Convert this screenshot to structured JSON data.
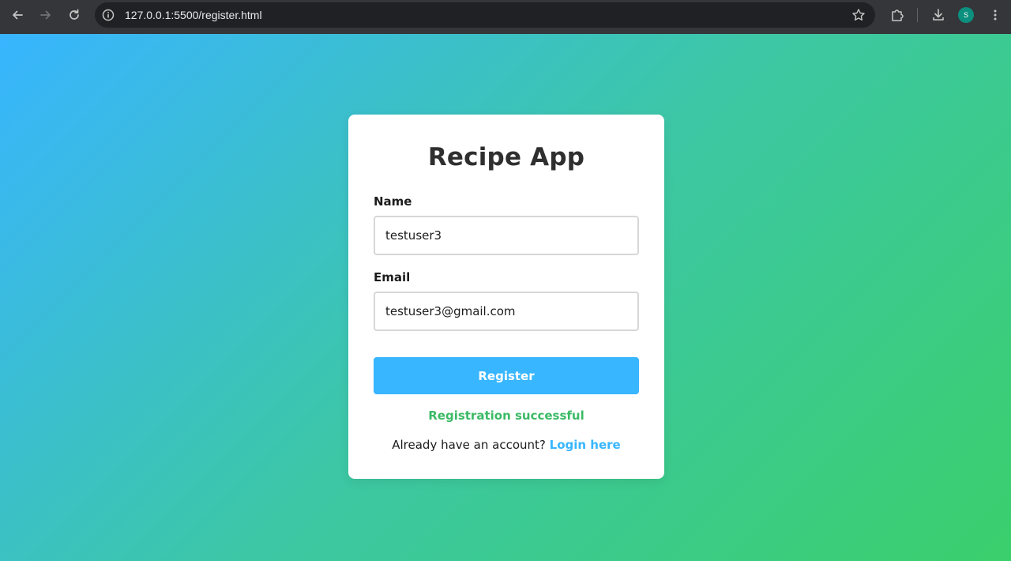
{
  "browser": {
    "url": "127.0.0.1:5500/register.html",
    "avatar_letter": "S"
  },
  "form": {
    "title": "Recipe App",
    "name_label": "Name",
    "name_value": "testuser3",
    "email_label": "Email",
    "email_value": "testuser3@gmail.com",
    "submit_label": "Register",
    "status_message": "Registration successful",
    "login_prompt": "Already have an account?",
    "login_link": "Login here"
  },
  "colors": {
    "accent": "#38b6ff",
    "success": "#3cba66",
    "gradient_start": "#38b5ff",
    "gradient_end": "#3bcf6c"
  }
}
